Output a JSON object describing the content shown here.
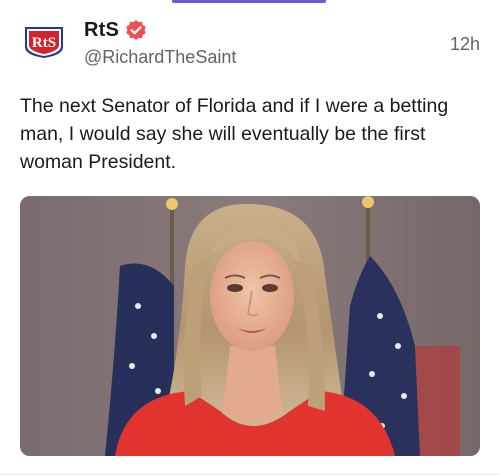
{
  "post": {
    "author": {
      "display_name": "RtS",
      "handle": "@RichardTheSaint",
      "avatar_text": "RtS",
      "verified": true,
      "avatar_icon": "rts-logo-icon",
      "verified_icon": "verified-badge-icon"
    },
    "timestamp": "12h",
    "text": "The next Senator of Florida and if I were a betting man, I would say she will eventually be the first woman President.",
    "media": {
      "type": "photo",
      "icon": "photo-icon"
    }
  },
  "colors": {
    "accent": "#6b5bd6",
    "verified_badge": "#ef4f4f",
    "logo_red": "#d3242b",
    "logo_blue": "#233a8a"
  }
}
